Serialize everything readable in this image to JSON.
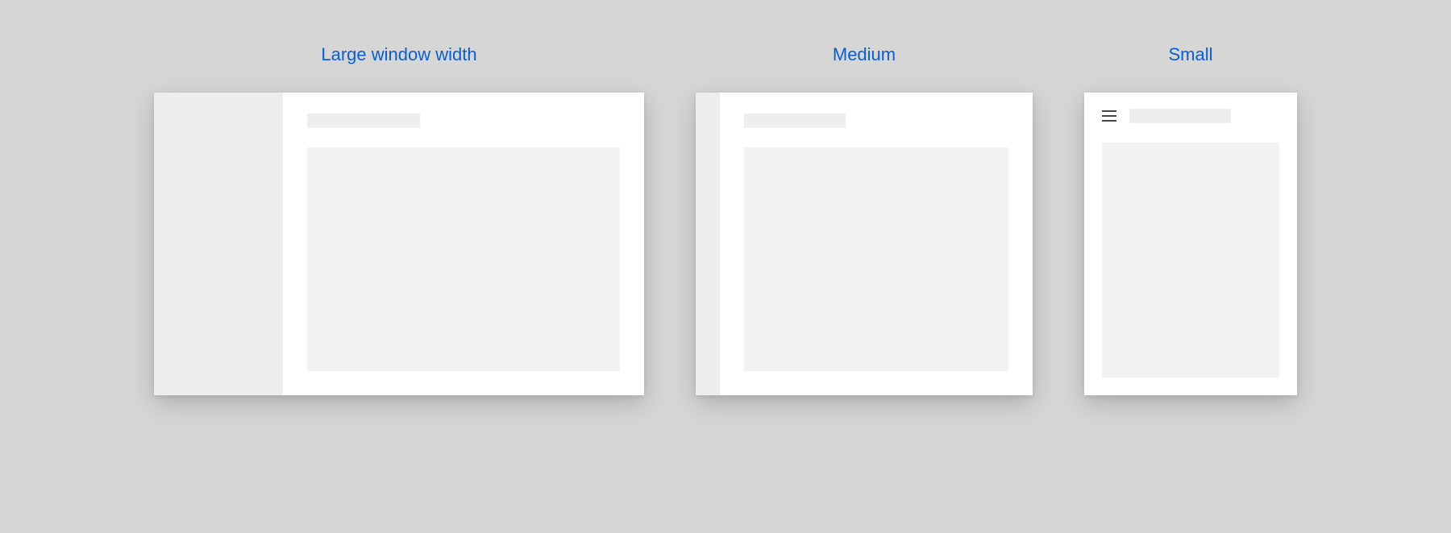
{
  "labels": {
    "large": "Large window width",
    "medium": "Medium",
    "small": "Small"
  }
}
